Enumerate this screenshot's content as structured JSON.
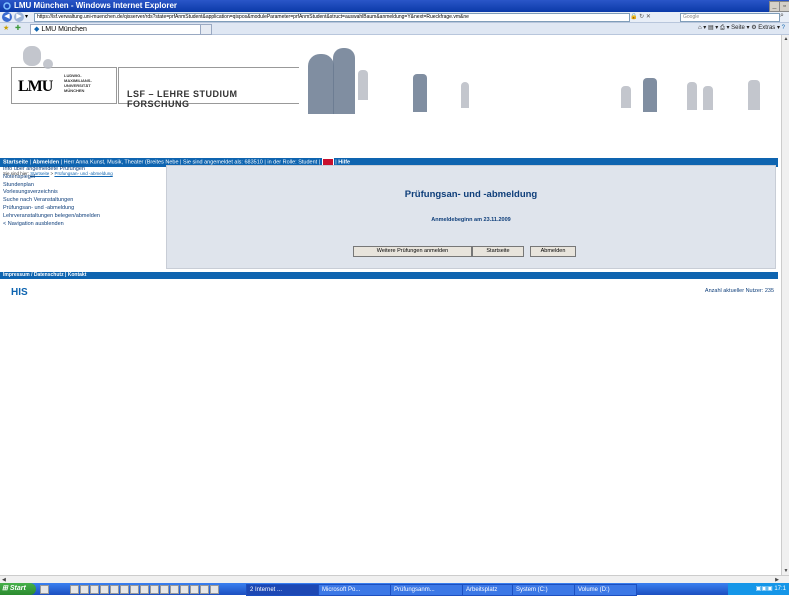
{
  "window": {
    "title": "LMU München - Windows Internet Explorer"
  },
  "addressbar": {
    "url": "https://lsf.verwaltung.uni-muenchen.de/qisserver/rds?state=prfAnmStudent&application=qispos&moduleParameter=prfAnmStudent&struct=auswahlBaum&anmeldung=Y&next=Rueckfrage.vm&ne",
    "search_placeholder": "Google"
  },
  "tabs": {
    "active_label": "LMU München"
  },
  "commandbar": {
    "page_label": "Seite",
    "extras_label": "Extras"
  },
  "header": {
    "lmu_logo": "LMU",
    "lmu_small_1": "LUDWIG-",
    "lmu_small_2": "MAXIMILIANS-",
    "lmu_small_3": "UNIVERSITÄT",
    "lmu_small_4": "MÜNCHEN",
    "lsf_title": "LSF – LEHRE STUDIUM FORSCHUNG"
  },
  "topnav": {
    "home": "Startseite",
    "logout": "Abmelden",
    "user_text": "Herr Anna Kunst, Musik, Theater (Breites Nebe",
    "logged_in_text": "Sie sind angemeldet als:",
    "user_id": "683510",
    "role_text": "in der Rolle: Student",
    "help": "Hilfe"
  },
  "breadcrumb": {
    "prefix": "Sie sind hier:",
    "home": "Startseite",
    "current": "Prüfungsan- und -abmeldung"
  },
  "sidebar": {
    "items": [
      {
        "label": "Info über angemeldete Prüfungen"
      },
      {
        "label": "Notenspiegel"
      },
      {
        "label": "Stundenplan"
      },
      {
        "label": "Vorlesungsverzeichnis"
      },
      {
        "label": "Suche nach Veranstaltungen"
      },
      {
        "label": "Prüfungsan- und -abmeldung"
      },
      {
        "label": "Lehrveranstaltungen belegen/abmelden"
      },
      {
        "label": "< Navigation ausblenden"
      }
    ]
  },
  "main": {
    "title": "Prüfungsan- und -abmeldung",
    "subtitle": "Anmeldebeginn am 23.11.2009",
    "buttons": {
      "more_exams": "Weitere Prüfungen anmelden",
      "home": "Startseite",
      "logout": "Abmelden"
    }
  },
  "footer": {
    "links": "Impressum / Datenschutz | Kontakt",
    "his_logo": "HIS",
    "users_label": "Anzahl aktueller Nutzer: 235"
  },
  "taskbar": {
    "start": "Start",
    "items": [
      {
        "label": "2 Internet ..."
      },
      {
        "label": "Microsoft Po..."
      },
      {
        "label": "Prüfungsanm..."
      },
      {
        "label": "Arbeitsplatz"
      },
      {
        "label": "System (C:)"
      },
      {
        "label": "Volume (D:)"
      }
    ],
    "clock": "17:1"
  },
  "colors": {
    "nav_blue": "#0e64b0",
    "text_blue": "#0e3e7a",
    "panel_bg": "#dfe4ec"
  }
}
